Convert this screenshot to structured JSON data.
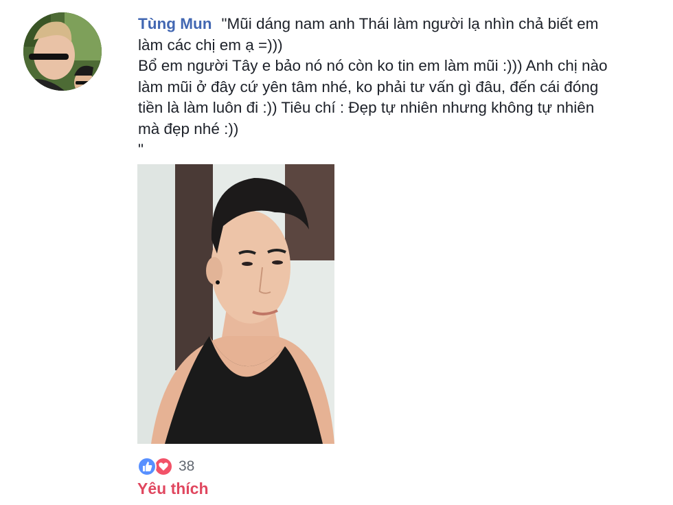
{
  "comment": {
    "author": "Tùng Mun",
    "line1": "\"Mũi dáng nam anh Thái làm người lạ nhìn chả biết em",
    "line2": "làm các chị em ạ =)))",
    "line3": "Bổ em người Tây e bảo nó nó còn ko tin em làm mũi :))) Anh chị nào",
    "line4": "làm mũi ở đây cứ yên tâm nhé, ko phải tư vấn gì đâu, đến cái đóng",
    "line5": "tiền là làm luôn đi :)) Tiêu chí : Đẹp tự nhiên nhưng không tự nhiên",
    "line6": "mà đẹp nhé :))",
    "line7": "\""
  },
  "avatar": {
    "icon": "profile-photo",
    "description_colors": [
      "#3c5a2a",
      "#7a9a5a"
    ]
  },
  "photo": {
    "icon": "selfie-photo"
  },
  "reactions": {
    "icons": [
      "like-icon",
      "love-icon"
    ],
    "count": "38",
    "label": "Yêu thích",
    "colors": {
      "like": "#5890ff",
      "love": "#f25268",
      "label": "#e0475f",
      "author": "#4267b2"
    }
  }
}
